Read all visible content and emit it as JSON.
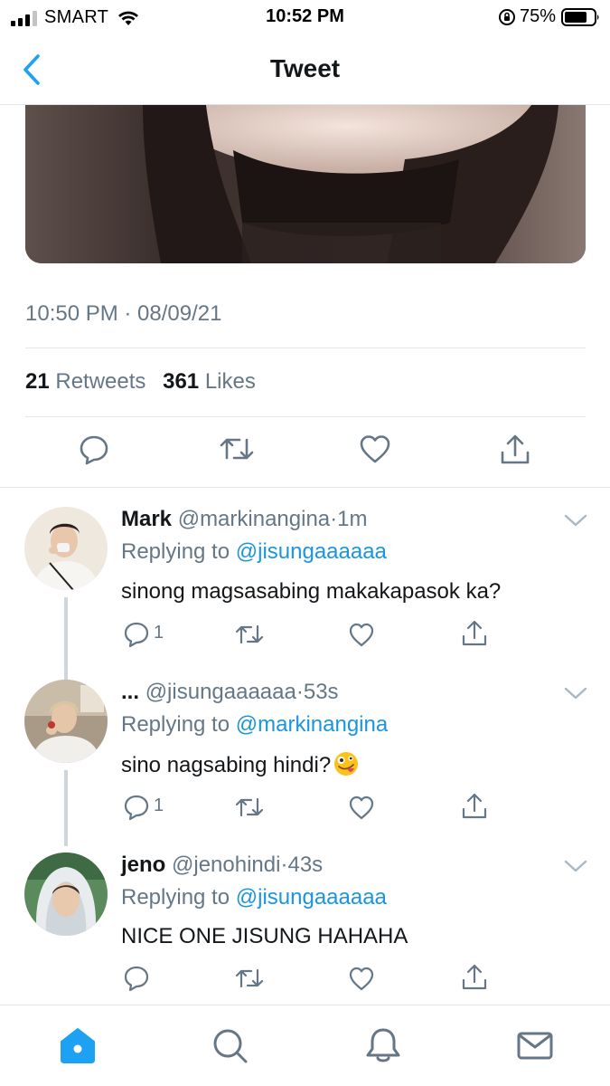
{
  "status_bar": {
    "carrier": "SMART",
    "time": "10:52 PM",
    "battery_percent": "75%"
  },
  "header": {
    "title": "Tweet"
  },
  "tweet": {
    "timestamp": "10:50 PM · 08/09/21",
    "retweet_count": "21",
    "retweet_label": "Retweets",
    "like_count": "361",
    "like_label": "Likes"
  },
  "replies": [
    {
      "name": "Mark",
      "handle": "@markinangina",
      "time": "1m",
      "replying_label": "Replying to",
      "replying_to": "@jisungaaaaaa",
      "text": "sinong magsasabing makakapasok ka?",
      "reply_count": "1",
      "emoji": ""
    },
    {
      "name": "...",
      "handle": "@jisungaaaaaa",
      "time": "53s",
      "replying_label": "Replying to",
      "replying_to": "@markinangina",
      "text": "sino nagsabing hindi?",
      "reply_count": "1",
      "emoji": "zany-face-emoji"
    },
    {
      "name": "jeno",
      "handle": "@jenohindi",
      "time": "43s",
      "replying_label": "Replying to",
      "replying_to": "@jisungaaaaaa",
      "text": "NICE ONE JISUNG HAHAHA",
      "reply_count": "",
      "emoji": ""
    }
  ],
  "icons": {
    "back": "chevron-left-icon",
    "reply": "reply-icon",
    "retweet": "retweet-icon",
    "like": "heart-icon",
    "share": "share-icon",
    "more": "chevron-down-icon",
    "tab_home": "home-icon",
    "tab_search": "search-icon",
    "tab_notifications": "bell-icon",
    "tab_messages": "mail-icon"
  },
  "colors": {
    "accent": "#1da1f2",
    "link": "#1b95e0",
    "muted": "#657786",
    "text": "#14171a",
    "border": "#e1e8ed"
  }
}
